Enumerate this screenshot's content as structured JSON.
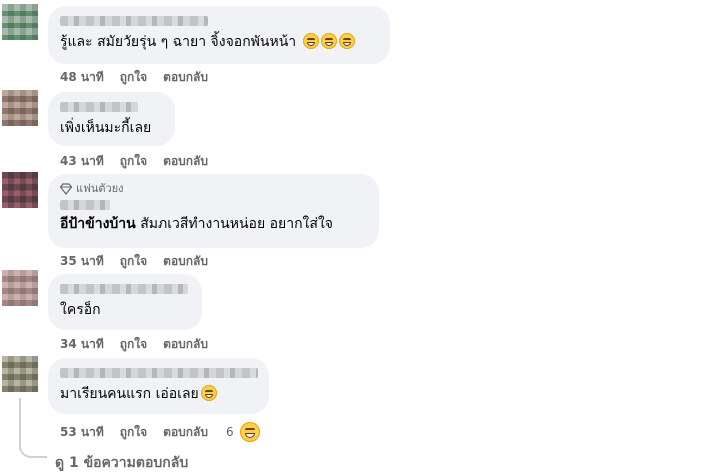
{
  "comments": [
    {
      "text": "รู้และ สมัยวัยรุ่น ๆ ฉายา จิ้งจอกพันหน้า",
      "emoji_count": 3,
      "time": "48 นาที",
      "like": "ถูกใจ",
      "reply": "ตอบกลับ"
    },
    {
      "text": "เพิ่งเห็นมะกี้เลย",
      "time": "43 นาที",
      "like": "ถูกใจ",
      "reply": "ตอบกลับ"
    },
    {
      "badge": "แฟนตัวยง",
      "text_bold": "อีป้าข้างบ้าน",
      "text": " สัมภเวสีทำงานหน่อย อยากใส่ใจ",
      "time": "35 นาที",
      "like": "ถูกใจ",
      "reply": "ตอบกลับ"
    },
    {
      "text": "ใครอ็ก",
      "time": "34 นาที",
      "like": "ถูกใจ",
      "reply": "ตอบกลับ"
    },
    {
      "text": "มาเรียนคนแรก เอ่อเลย",
      "time": "53 นาที",
      "like": "ถูกใจ",
      "reply": "ตอบกลับ",
      "reaction_count": "6"
    }
  ],
  "view_replies": "ดู 1 ข้อความตอบกลับ",
  "colors": {
    "bubble": "#f0f2f5",
    "meta": "#65676b",
    "text": "#050505"
  }
}
